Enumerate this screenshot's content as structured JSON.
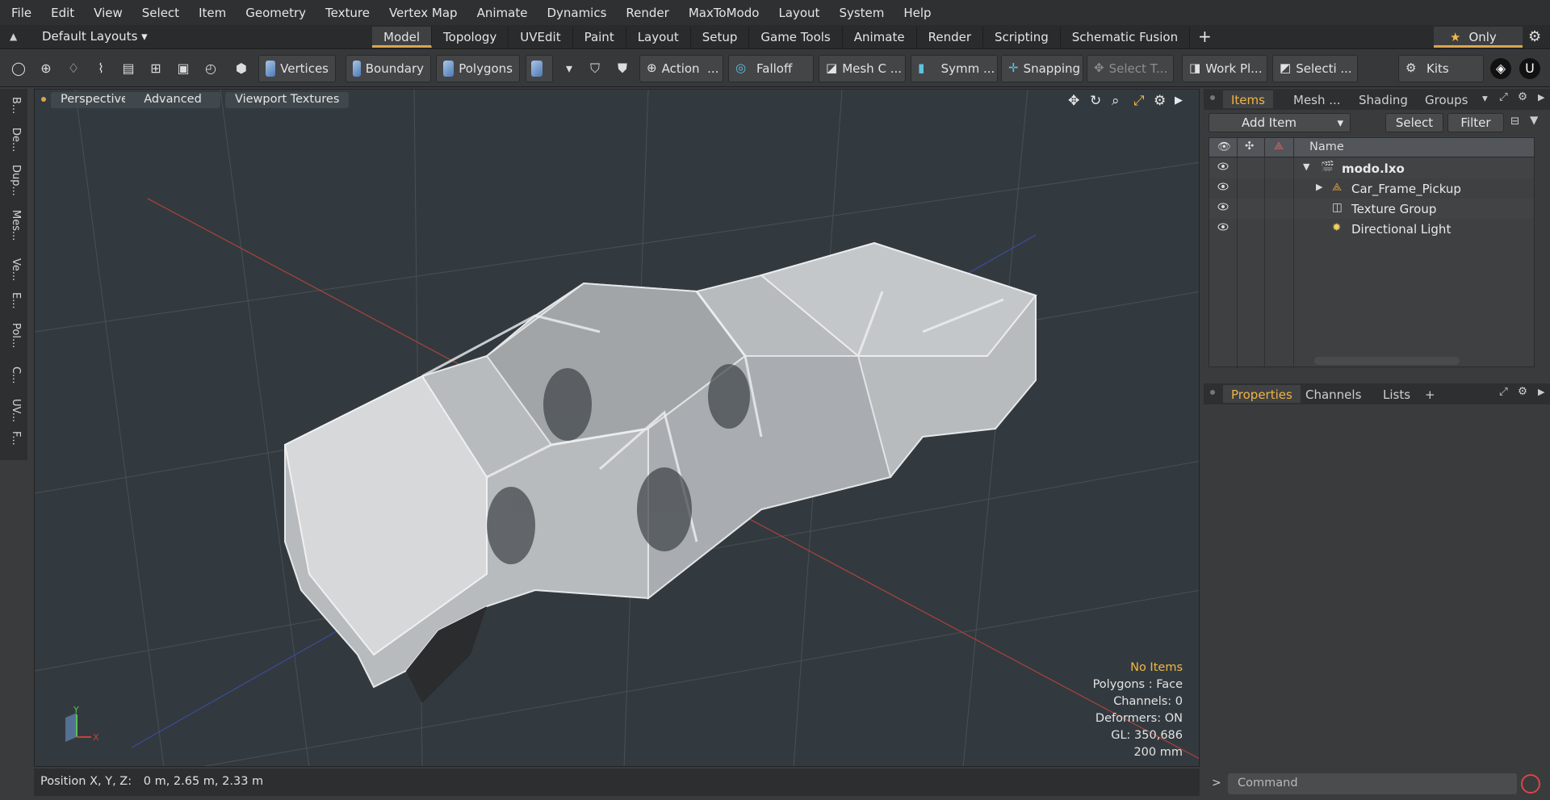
{
  "menubar": {
    "items": [
      "File",
      "Edit",
      "View",
      "Select",
      "Item",
      "Geometry",
      "Texture",
      "Vertex Map",
      "Animate",
      "Dynamics",
      "Render",
      "MaxToModo",
      "Layout",
      "System",
      "Help"
    ]
  },
  "layoutbar": {
    "layout_name": "Default Layouts",
    "tabs": [
      "Model",
      "Topology",
      "UVEdit",
      "Paint",
      "Layout",
      "Setup",
      "Game Tools",
      "Animate",
      "Render",
      "Scripting",
      "Schematic Fusion"
    ],
    "active_tab": "Model",
    "only_label": "Only"
  },
  "toolbar": {
    "vertices": "Vertices",
    "boundary": "Boundary",
    "polygons": "Polygons",
    "action": "Action",
    "action_more": "...",
    "falloff": "Falloff",
    "mesh": "Mesh C ...",
    "symm": "Symm ...",
    "snapping": "Snapping",
    "select_t": "Select T...",
    "work_plane": "Work Pl...",
    "selection": "Selecti ...",
    "kits": "Kits"
  },
  "lefttabs": [
    "B...",
    "De...",
    "Dup...",
    "Mes...",
    "Ve...",
    "E...",
    "Pol...",
    "C...",
    "UV...",
    "F..."
  ],
  "viewport": {
    "view_mode": "Perspective",
    "advanced": "Advanced",
    "textures": "Viewport Textures",
    "info": {
      "selection": "No Items",
      "polygons": "Polygons : Face",
      "channels": "Channels: 0",
      "deformers": "Deformers: ON",
      "gl": "GL: 350,686",
      "scale": "200 mm"
    },
    "gizmo_labels": {
      "y": "Y",
      "x": "X"
    }
  },
  "status": {
    "position_label": "Position X, Y, Z:",
    "position_value": "0 m, 2.65 m, 2.33 m"
  },
  "items_panel": {
    "tabs": [
      "Items",
      "Mesh ...",
      "Shading",
      "Groups"
    ],
    "active_tab": "Items",
    "add_item": "Add Item",
    "select": "Select",
    "filter": "Filter",
    "name_header": "Name",
    "rows": [
      {
        "name": "modo.lxo",
        "icon": "scene-icon"
      },
      {
        "name": "Car_Frame_Pickup",
        "icon": "mesh-locator-icon"
      },
      {
        "name": "Texture Group",
        "icon": "texture-group-icon"
      },
      {
        "name": "Directional Light",
        "icon": "light-icon"
      }
    ]
  },
  "properties_panel": {
    "tabs": [
      "Properties",
      "Channels",
      "Lists"
    ],
    "active_tab": "Properties",
    "add": "+"
  },
  "command": {
    "placeholder": "Command"
  },
  "colors": {
    "accent": "#d8a64a",
    "highlight_text": "#f2b844",
    "viewport_bg": "#333a3f",
    "grid_x": "#c0443a",
    "grid_z": "#3c4fb0"
  }
}
